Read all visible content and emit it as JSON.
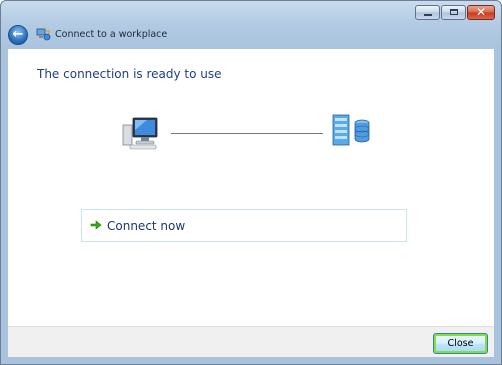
{
  "window": {
    "title": "Connect to a workplace",
    "controls": {
      "minimize": "minimize",
      "maximize": "maximize",
      "close": "✕"
    }
  },
  "nav": {
    "back_glyph": "←"
  },
  "main": {
    "heading": "The connection is ready to use",
    "diagram": {
      "left_icon": "computer-icon",
      "right_icon": "server-icon"
    },
    "action": {
      "label": "Connect now",
      "icon": "green-arrow-icon"
    }
  },
  "footer": {
    "close_label": "Close"
  },
  "colors": {
    "heading": "#1f3d8a",
    "accent_green": "#3aa81c",
    "titlebar": "#b3cbe3"
  }
}
